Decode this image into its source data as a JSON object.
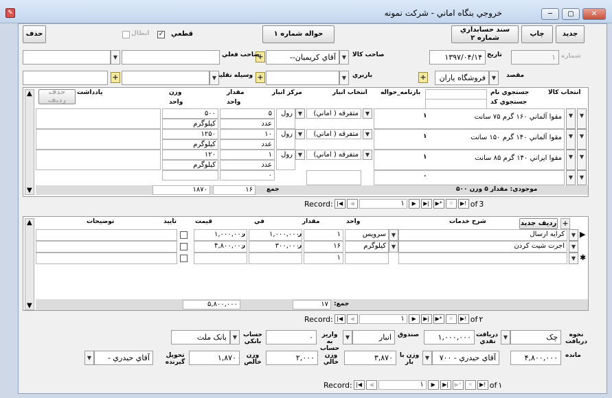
{
  "window": {
    "title": "خروجي بنگاه اماني - شرکت نمونه",
    "close": "✕",
    "restore": "▢",
    "minimize": "─",
    "app_icon": "✎"
  },
  "toolbar": {
    "new": "جديد",
    "print": "چاپ",
    "voucher": "سند حسابداري\nشماره ۲",
    "transfer": "حواله شماره ۱",
    "delete": "حذف",
    "final_label": "قطعي",
    "final_check": "✓",
    "cancel_label": "ابطال"
  },
  "header": {
    "number_label": "شماره",
    "number_value": "۱",
    "date_label": "تاريخ",
    "date_value": "۱۳۹۷/۰۴/۱۴",
    "goods_owner_label": "صاحب کالا",
    "goods_owner_value": "آقاي کريميان--",
    "current_owner_label": "صاحب فعلي",
    "current_owner_value": "",
    "destination_label": "مقصد",
    "destination_value": "فروشگاه ياران",
    "loader_label": "باربري",
    "loader_value": "",
    "vehicle_label": "وسيله نقليه",
    "vehicle_value": ""
  },
  "goods": {
    "headers": {
      "select": "انتخاب کالا",
      "search_name": "جستجوي نام",
      "search_code": "جستجوي کد",
      "bar_no": "بارنامه_حواله",
      "warehouse_sel": "انتخاب انبار",
      "warehouse_center": "مرکز انبار",
      "amount": "مقدار",
      "amount_unit": "واحد",
      "weight": "وزن",
      "weight_unit": "واحد",
      "notes": "يادداشت",
      "del_row": "حذف رديف"
    },
    "rows": [
      {
        "name": "مقوا آلماني ۱۶۰ گرم ۷۵ سانت",
        "idx": "۱",
        "wh": "متفرقه ( اماني)",
        "center": "رول",
        "qty": "۵",
        "qty_unit": "عدد",
        "weight": "۵۰۰",
        "weight_unit": "کيلوگرم"
      },
      {
        "name": "مقوا آلماني ۱۴۰ گرم ۱۵۰ سانت",
        "idx": "۱",
        "wh": "متفرقه ( اماني)",
        "center": "رول",
        "qty": "۱۰",
        "qty_unit": "عدد",
        "weight": "۱۲۵۰",
        "weight_unit": "کيلوگرم"
      },
      {
        "name": "مقوا ايراني ۱۴۰ گرم ۸۵ سانت",
        "idx": "۱",
        "wh": "متفرقه ( اماني)",
        "center": "رول",
        "qty": "۱",
        "qty_unit": "عدد",
        "weight": "۱۲۰",
        "weight_unit": "کيلوگرم"
      }
    ],
    "new_row": {
      "idx": "۰",
      "qty": "۰"
    },
    "stock": "موجودي: مقدار ۵ وزن ۵۰۰",
    "sum_label": "جمع",
    "sum_qty": "۱۶",
    "sum_weight": "۱۸۷۰",
    "nav": {
      "label": "Record:",
      "current": "۱",
      "of": "of",
      "total": "3"
    }
  },
  "services": {
    "headers": {
      "add": "رديف جديد",
      "desc": "شرح خدمات",
      "unit": "واحد",
      "qty": "مقدار",
      "price": "في",
      "total": "قيمت",
      "confirm": "تاييد",
      "notes": "توضيحات"
    },
    "rows": [
      {
        "desc": "کرايه ارسال",
        "unit": "سرويس",
        "qty": "۱",
        "price": "۱,۰۰۰,۰۰۰",
        "total": "۱,۰۰۰,۰۰۰",
        "cur": "ر"
      },
      {
        "desc": "اجرت شيت کردن",
        "unit": "کيلوگرم",
        "qty": "۱۶",
        "price": "۳۰۰,۰۰۰",
        "total": "۴,۸۰۰,۰۰۰",
        "cur": "ر"
      }
    ],
    "new_row": {
      "qty": "۱"
    },
    "sum_label": "جمع:",
    "sum_qty": "۱۷",
    "sum_total": "۵,۸۰۰,۰۰۰",
    "cur": "ر",
    "nav": {
      "label": "Record:",
      "current": "۱",
      "of": "of",
      "total": "۲"
    }
  },
  "footer": {
    "pay_method_label": "نحوه دريافت",
    "pay_method_value": "چک",
    "cash_label": "دريافت نقدي",
    "cash_value": "۱,۰۰۰,۰۰۰",
    "cashbox_label": "صندوق",
    "cashbox_value": "انبار",
    "deposit_label": "واريز به حساب",
    "deposit_value": "۰",
    "bank_label": "حساب بانکي",
    "bank_value": "بانک ملت",
    "remain_label": "مانده",
    "remain_value": "۴,۸۰۰,۰۰۰",
    "person_value": "آقاي حيدري - ۷۰۰",
    "gross_label": "وزن با بار",
    "gross_value": "۳,۸۷۰",
    "empty_label": "وزن خالي",
    "empty_value": "۲,۰۰۰",
    "net_label": "وزن خالص",
    "net_value": "۱,۸۷۰",
    "receiver_label": "تحويل گيرنده",
    "receiver_value": "آقاي حيدري -",
    "cur": "ر"
  },
  "main_nav": {
    "label": "Record:",
    "current": "۱",
    "of": "of",
    "total": "۱"
  }
}
